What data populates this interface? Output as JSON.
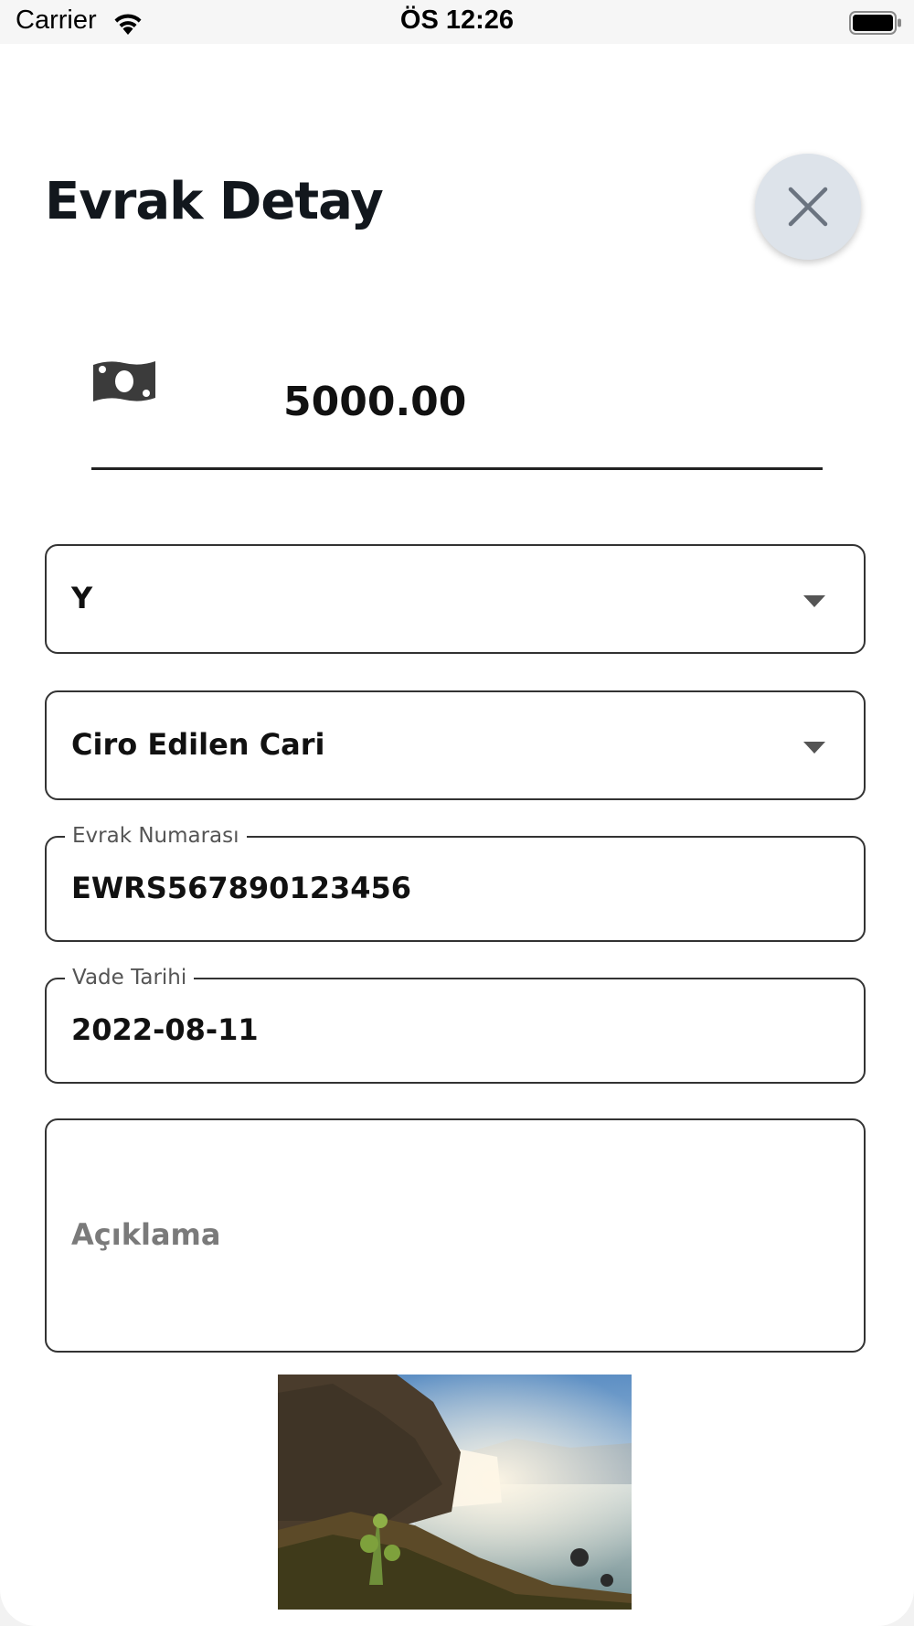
{
  "status_bar": {
    "carrier": "Carrier",
    "time": "ÖS 12:26",
    "wifi_icon": "wifi-icon",
    "battery_icon": "battery-icon"
  },
  "header": {
    "title": "Evrak Detay",
    "close_icon": "close-icon"
  },
  "amount": {
    "icon": "money-icon",
    "value": "5000.00"
  },
  "form": {
    "type_select": {
      "value": "Y",
      "icon": "chevron-down-icon"
    },
    "cari_select": {
      "value": "Ciro Edilen Cari",
      "icon": "chevron-down-icon"
    },
    "evrak_numarasi": {
      "label": "Evrak Numarası",
      "value": "EWRS567890123456"
    },
    "vade_tarihi": {
      "label": "Vade Tarihi",
      "value": "2022-08-11"
    },
    "aciklama": {
      "placeholder": "Açıklama",
      "value": ""
    }
  },
  "attachment": {
    "image_icon": "waterfall-photo"
  },
  "colors": {
    "close_button_bg": "#dde3ea",
    "border": "#333333",
    "placeholder": "#7a7a7a"
  }
}
